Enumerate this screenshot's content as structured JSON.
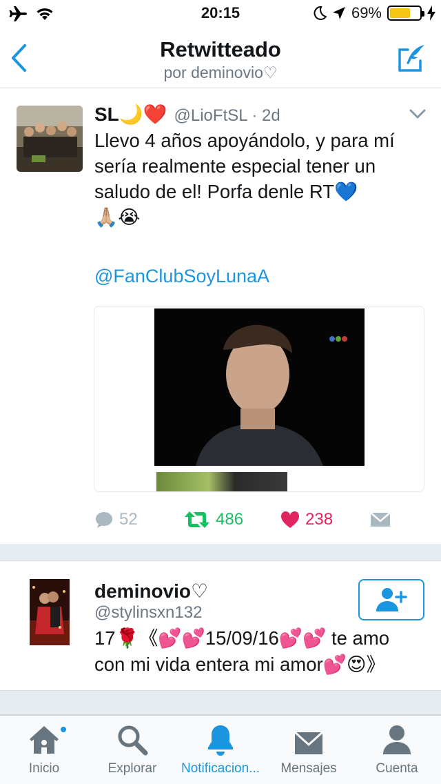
{
  "status_bar": {
    "time": "20:15",
    "battery_percent": "69%",
    "battery_level": 0.69,
    "icons": [
      "airplane-icon",
      "wifi-icon",
      "moon-icon",
      "location-arrow-icon",
      "battery-icon",
      "charging-bolt-icon"
    ]
  },
  "nav": {
    "title": "Retwitteado",
    "subtitle": "por deminovio♡",
    "back_icon": "chevron-left-icon",
    "compose_icon": "compose-icon"
  },
  "tweet1": {
    "name": "SL🌙❤️",
    "handle": "@LioFtSL · 2d",
    "lines": [
      "Llevo 4 años apoyándolo, y para mí",
      "sería realmente especial tener un",
      "saludo de el! Porfa denle RT💙",
      "🙏🏼😭"
    ],
    "mention": "@FanClubSoyLunaA",
    "replies": "52",
    "retweets": "486",
    "likes": "238"
  },
  "tweet2": {
    "name": "deminovio♡",
    "handle": "@stylinsxn132",
    "lines": [
      "17🌹《💕💕15/09/16💕💕 te amo",
      "con mi vida entera mi amor💕😍》"
    ]
  },
  "tabbar": {
    "tabs": [
      {
        "label": "Inicio",
        "icon": "home-icon"
      },
      {
        "label": "Explorar",
        "icon": "search-icon"
      },
      {
        "label": "Notificacion...",
        "icon": "bell-icon"
      },
      {
        "label": "Mensajes",
        "icon": "envelope-icon"
      },
      {
        "label": "Cuenta",
        "icon": "person-icon"
      }
    ]
  },
  "colors": {
    "accent": "#1b95e0",
    "retweet_green": "#17bf63",
    "like_red": "#e0245e",
    "secondary_text": "#6b7783"
  }
}
